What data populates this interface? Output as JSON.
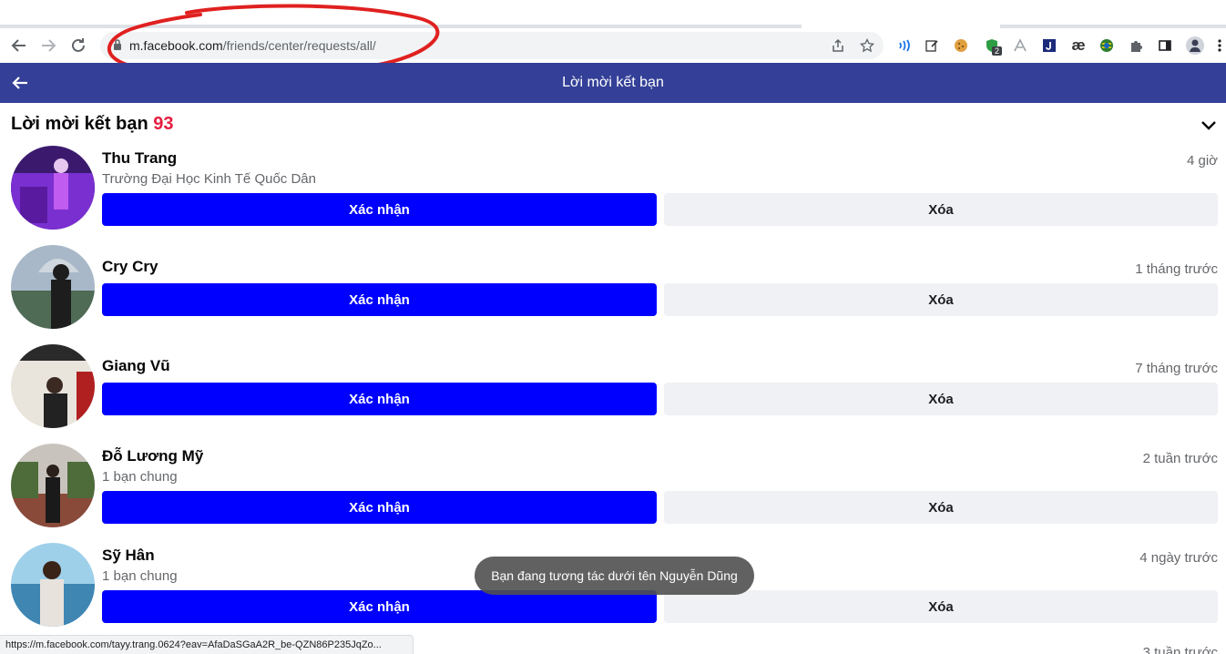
{
  "browser": {
    "url_domain": "m.facebook.com",
    "url_path": "/friends/center/requests/all/",
    "extension_badge": "2",
    "ext_ae": "æ",
    "status_url": "https://m.facebook.com/tayy.trang.0624?eav=AfaDaSGaA2R_be-QZN86P235JqZo..."
  },
  "header": {
    "title": "Lời mời kết bạn"
  },
  "section": {
    "title": "Lời mời kết bạn",
    "count": "93"
  },
  "buttons": {
    "confirm": "Xác nhận",
    "delete": "Xóa"
  },
  "requests": [
    {
      "name": "Thu Trang",
      "subtitle": "Trường Đại Học Kinh Tế Quốc Dân",
      "time": "4 giờ",
      "avatar_color": "#7a2fd0"
    },
    {
      "name": "Cry Cry",
      "subtitle": "",
      "time": "1 tháng trước",
      "avatar_color": "#6f8aa3"
    },
    {
      "name": "Giang Vũ",
      "subtitle": "",
      "time": "7 tháng trước",
      "avatar_color": "#d9d2c5"
    },
    {
      "name": "Đỗ Lương Mỹ",
      "subtitle": "1 bạn chung",
      "time": "2 tuần trước",
      "avatar_color": "#8a6a5a"
    },
    {
      "name": "Sỹ Hân",
      "subtitle": "1 bạn chung",
      "time": "4 ngày trước",
      "avatar_color": "#5fa3c7"
    }
  ],
  "partial_time": "3 tuần trước",
  "toast": "Bạn đang tương tác dưới tên Nguyễn Dũng",
  "colors": {
    "header_bg": "#344097",
    "confirm_bg": "#0000ff",
    "delete_bg": "#f0f1f4",
    "count": "#e41e3f",
    "annotation": "#e02020"
  }
}
